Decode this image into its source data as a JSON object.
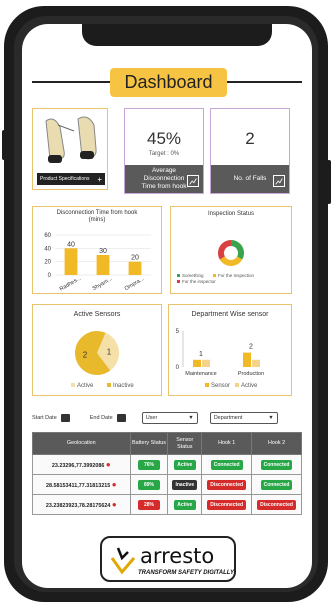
{
  "header": {
    "title": "Dashboard"
  },
  "product": {
    "button_label": "Product Specifications",
    "button_icon": "plus-icon"
  },
  "kpis": [
    {
      "value": "45%",
      "sub": "Target : 0%",
      "label": "Average Disconnection Time from hook",
      "icon": "chart-icon"
    },
    {
      "value": "2",
      "label": "No. of Falls",
      "icon": "chart-icon"
    }
  ],
  "charts": {
    "disconnection": {
      "title": "Disconnection Time from hook",
      "unit": "(mins)"
    },
    "inspection": {
      "title": "Inspection Status"
    },
    "sensors": {
      "title": "Active Sensors"
    },
    "department": {
      "title": "Department Wise sensor"
    }
  },
  "chart_data": [
    {
      "type": "bar",
      "title": "Disconnection Time from hook",
      "ylabel": "(mins)",
      "ylim": [
        0,
        60
      ],
      "yticks": [
        "60",
        "40",
        "20",
        "0"
      ],
      "categories": [
        "Radhes...",
        "Shyam...",
        "Ompra..."
      ],
      "values": [
        40,
        30,
        20
      ],
      "colors": [
        "#f2b926",
        "#f2b926",
        "#f2b926"
      ]
    },
    {
      "type": "pie",
      "title": "Inspection Status",
      "legend": [
        "Something",
        "For the Inspection",
        "For the inspector"
      ],
      "values": [
        1,
        1,
        1
      ],
      "colors": [
        "#3aa34b",
        "#f2b926",
        "#d94040"
      ]
    },
    {
      "type": "pie",
      "title": "Active Sensors",
      "labels": [
        "1",
        "2"
      ],
      "legend": [
        "Active",
        "Inactive"
      ],
      "values": [
        1,
        2
      ],
      "colors": [
        "#f5e0a8",
        "#e8b92b"
      ]
    },
    {
      "type": "bar",
      "title": "Department Wise sensor",
      "ylim": [
        0,
        5
      ],
      "yticks": [
        "5",
        "0"
      ],
      "categories": [
        "Maintenance",
        "Production"
      ],
      "series": [
        {
          "name": "Sensor",
          "values": [
            1,
            2
          ],
          "color": "#f2b926"
        },
        {
          "name": "Active",
          "values": [
            1,
            1
          ],
          "color": "#f5d38a"
        }
      ],
      "labels": [
        "1",
        "2"
      ]
    }
  ],
  "filters": {
    "start_label": "Start Date",
    "end_label": "End Date",
    "user": "User",
    "department": "Department"
  },
  "table": {
    "headers": [
      "Geolocation",
      "Battery Status",
      "Sensor Status",
      "Hook 1",
      "Hook 2"
    ],
    "rows": [
      {
        "geo": "23.23296,77.3992086",
        "battery": "76%",
        "battery_color": "#27a745",
        "sensor": "Active",
        "sensor_color": "#27a745",
        "h1": "Connected",
        "h1_color": "#27a745",
        "h2": "Connected",
        "h2_color": "#27a745"
      },
      {
        "geo": "28.58153411,77.31813215",
        "battery": "89%",
        "battery_color": "#27a745",
        "sensor": "Inactive",
        "sensor_color": "#333333",
        "h1": "Disconnected",
        "h1_color": "#d62b2b",
        "h2": "Connected",
        "h2_color": "#27a745"
      },
      {
        "geo": "23.23823923,78.28175624",
        "battery": "28%",
        "battery_color": "#d62b2b",
        "sensor": "Active",
        "sensor_color": "#27a745",
        "h1": "Disconnected",
        "h1_color": "#d62b2b",
        "h2": "Disconnected",
        "h2_color": "#d62b2b"
      }
    ]
  },
  "logo": {
    "name": "arresto",
    "tagline": "TRANSFORM SAFETY DIGITALLY"
  }
}
